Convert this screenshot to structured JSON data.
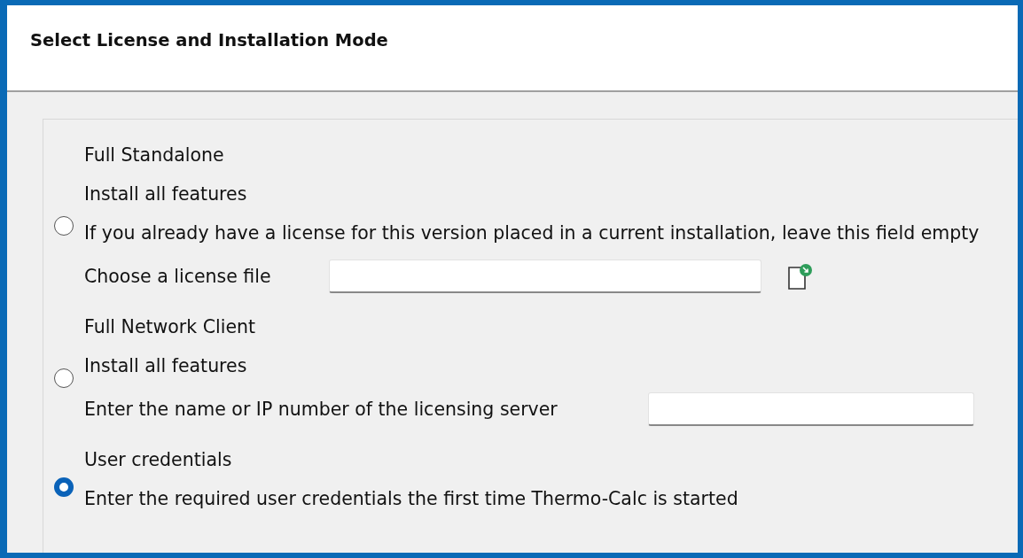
{
  "header": {
    "title": "Select License and Installation Mode"
  },
  "options": [
    {
      "selected": false,
      "title": "Full Standalone",
      "description": "Install all features",
      "note": "If you already have a license for this version placed in a current installation, leave this field empty",
      "field": {
        "label": "Choose a license file",
        "kind": "file"
      }
    },
    {
      "selected": false,
      "title": "Full Network Client",
      "description": "Install all features",
      "field": {
        "label": "Enter the name or IP number of the licensing server",
        "kind": "text"
      }
    },
    {
      "selected": true,
      "title": "User credentials",
      "description": "Enter the required user credentials the first time Thermo-Calc is started"
    }
  ]
}
